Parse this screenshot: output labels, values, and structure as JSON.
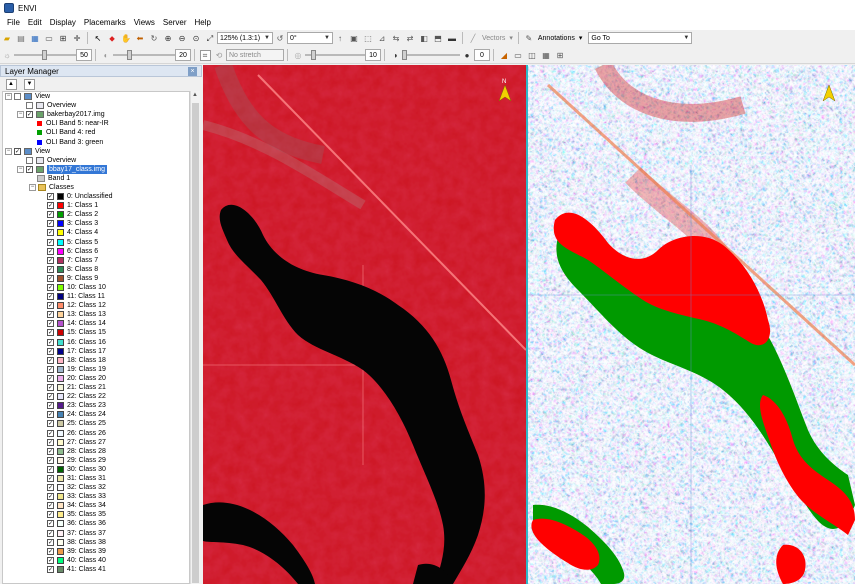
{
  "app": {
    "title": "ENVI"
  },
  "menu": [
    "File",
    "Edit",
    "Display",
    "Placemarks",
    "Views",
    "Server",
    "Help"
  ],
  "toolbar": {
    "zoom": "125% (1.3:1)",
    "rotation": "0°",
    "vector_label": "Vectors",
    "annotations_label": "Annotations",
    "goto_label": "Go To"
  },
  "toolbar2": {
    "brightness": "50",
    "contrast": "20",
    "stretch": "No stretch",
    "sharpen": "10",
    "transparency": "0"
  },
  "layer_manager": {
    "title": "Layer Manager",
    "tree": [
      {
        "level": 0,
        "type": "view",
        "label": "View",
        "checked": false,
        "exp": "−"
      },
      {
        "level": 1,
        "type": "overview",
        "label": "Overview",
        "checked": false
      },
      {
        "level": 1,
        "type": "raster",
        "label": "bakerbay2017.img",
        "checked": true,
        "exp": "−"
      },
      {
        "level": 2,
        "type": "band",
        "label": "OLI Band 5: near-IR",
        "color": "#ff0000"
      },
      {
        "level": 2,
        "type": "band",
        "label": "OLI Band 4: red",
        "color": "#00a000"
      },
      {
        "level": 2,
        "type": "band",
        "label": "OLI Band 3: green",
        "color": "#0000ff"
      },
      {
        "level": 0,
        "type": "view",
        "label": "View",
        "checked": true,
        "exp": "−"
      },
      {
        "level": 1,
        "type": "overview",
        "label": "Overview",
        "checked": false
      },
      {
        "level": 1,
        "type": "raster",
        "label": "bbay17_class.img",
        "checked": true,
        "exp": "−",
        "selected": true
      },
      {
        "level": 2,
        "type": "bandplain",
        "label": "Band 1"
      },
      {
        "level": 2,
        "type": "folder",
        "label": "Classes",
        "exp": "−"
      }
    ],
    "classes": [
      {
        "label": "0: Unclassified",
        "color": "#000000"
      },
      {
        "label": "1: Class 1",
        "color": "#ff0000"
      },
      {
        "label": "2: Class 2",
        "color": "#00a000"
      },
      {
        "label": "3: Class 3",
        "color": "#0000ff"
      },
      {
        "label": "4: Class 4",
        "color": "#ffff00"
      },
      {
        "label": "5: Class 5",
        "color": "#00ffff"
      },
      {
        "label": "6: Class 6",
        "color": "#ff00ff"
      },
      {
        "label": "7: Class 7",
        "color": "#b03060"
      },
      {
        "label": "8: Class 8",
        "color": "#2e8b57"
      },
      {
        "label": "9: Class 9",
        "color": "#a0522d"
      },
      {
        "label": "10: Class 10",
        "color": "#7fff00"
      },
      {
        "label": "11: Class 11",
        "color": "#000080"
      },
      {
        "label": "12: Class 12",
        "color": "#ff8c69"
      },
      {
        "label": "13: Class 13",
        "color": "#ffd39b"
      },
      {
        "label": "14: Class 14",
        "color": "#b452cd"
      },
      {
        "label": "15: Class 15",
        "color": "#cd0000"
      },
      {
        "label": "16: Class 16",
        "color": "#40e0d0"
      },
      {
        "label": "17: Class 17",
        "color": "#00008b"
      },
      {
        "label": "18: Class 18",
        "color": "#ffb5c5"
      },
      {
        "label": "19: Class 19",
        "color": "#9fb6cd"
      },
      {
        "label": "20: Class 20",
        "color": "#eeaeee"
      },
      {
        "label": "21: Class 21",
        "color": "#f5f5dc"
      },
      {
        "label": "22: Class 22",
        "color": "#e6e6fa"
      },
      {
        "label": "23: Class 23",
        "color": "#551a8b"
      },
      {
        "label": "24: Class 24",
        "color": "#4682b4"
      },
      {
        "label": "25: Class 25",
        "color": "#cdc9a5"
      },
      {
        "label": "26: Class 26",
        "color": "#f0f8ff"
      },
      {
        "label": "27: Class 27",
        "color": "#fffacd"
      },
      {
        "label": "28: Class 28",
        "color": "#8fbc8f"
      },
      {
        "label": "29: Class 29",
        "color": "#fdf5e6"
      },
      {
        "label": "30: Class 30",
        "color": "#006400"
      },
      {
        "label": "31: Class 31",
        "color": "#eee8aa"
      },
      {
        "label": "32: Class 32",
        "color": "#fafafa"
      },
      {
        "label": "33: Class 33",
        "color": "#f0e68c"
      },
      {
        "label": "34: Class 34",
        "color": "#ffe4c4"
      },
      {
        "label": "35: Class 35",
        "color": "#ffec8b"
      },
      {
        "label": "36: Class 36",
        "color": "#f5fffa"
      },
      {
        "label": "37: Class 37",
        "color": "#fff0f5"
      },
      {
        "label": "38: Class 38",
        "color": "#fffff0"
      },
      {
        "label": "39: Class 39",
        "color": "#ee9a49"
      },
      {
        "label": "40: Class 40",
        "color": "#00ff7f"
      },
      {
        "label": "41: Class 41",
        "color": "#698b69"
      }
    ]
  },
  "colors": {
    "water": "#000000",
    "land_ir": "#d2141e",
    "class_red": "#ff0000",
    "class_green": "#00a000",
    "divider": "#30b8c8"
  }
}
